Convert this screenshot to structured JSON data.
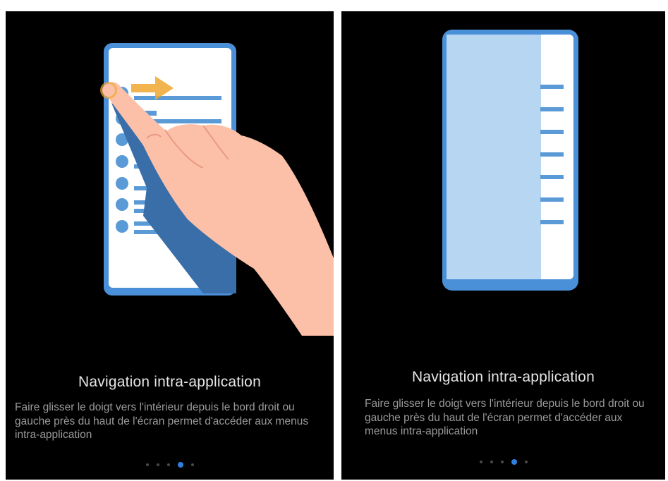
{
  "screens": [
    {
      "title": "Navigation intra-application",
      "description": "Faire glisser le doigt vers l'intérieur depuis le bord droit ou gauche près du haut de l'écran permet d'accéder aux menus intra-application",
      "pagination": {
        "total": 5,
        "active_index": 3
      }
    },
    {
      "title": "Navigation intra-application",
      "description": "Faire glisser le doigt vers l'intérieur depuis le bord droit ou gauche près du haut de l'écran permet d'accéder aux menus intra-application",
      "pagination": {
        "total": 5,
        "active_index": 3
      }
    }
  ],
  "colors": {
    "background": "#000000",
    "phone_frame": "#4a90d9",
    "phone_screen": "#ffffff",
    "list_items": "#5a9ad6",
    "side_menu": "#b6d6f1",
    "hand_skin": "#fcc0a8",
    "hand_shadow": "#3a6ea8",
    "arrow": "#f0a830",
    "title_text": "#e6e6e6",
    "description_text": "#9a9a9a",
    "dot_inactive": "#4a4a4a",
    "dot_active": "#2f7fe0"
  }
}
